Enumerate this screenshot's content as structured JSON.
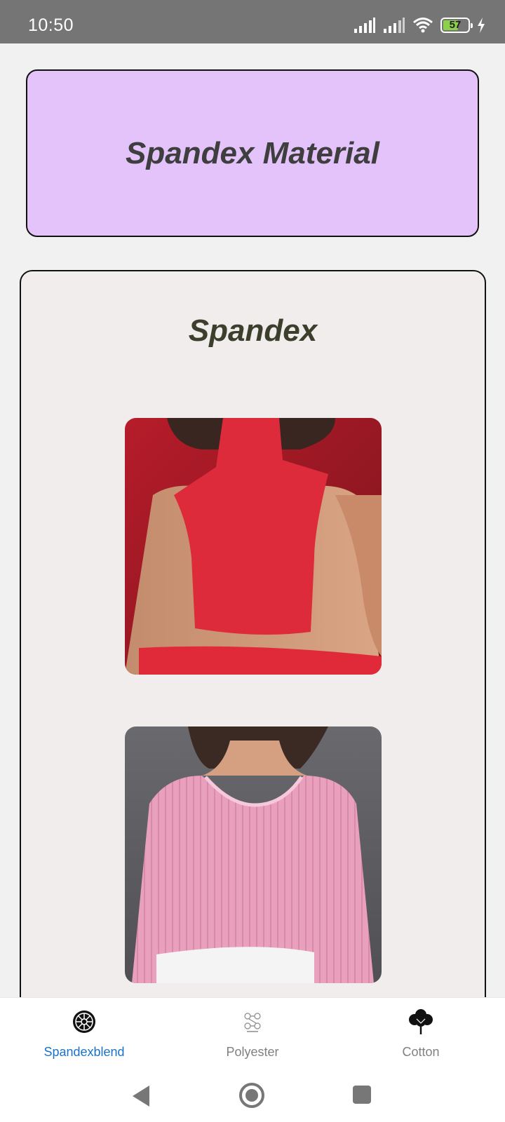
{
  "status_bar": {
    "time": "10:50",
    "battery": "57"
  },
  "header": {
    "title": "Spandex Material"
  },
  "section": {
    "title": "Spandex"
  },
  "products": [
    {
      "icon": "red-sleeveless-crop-top-photo"
    },
    {
      "icon": "pink-ribbed-long-sleeve-top-photo"
    }
  ],
  "bottom_nav": {
    "items": [
      {
        "label": "Spandexblend",
        "icon": "spandex-fabric-icon",
        "active": true
      },
      {
        "label": "Polyester",
        "icon": "polyester-molecule-icon",
        "active": false
      },
      {
        "label": "Cotton",
        "icon": "cotton-plant-icon",
        "active": false
      }
    ],
    "active_color": "#1a73c8",
    "inactive_color": "#808080"
  },
  "colors": {
    "header_bg": "#e4c3fb",
    "status_bar_bg": "#757575"
  }
}
